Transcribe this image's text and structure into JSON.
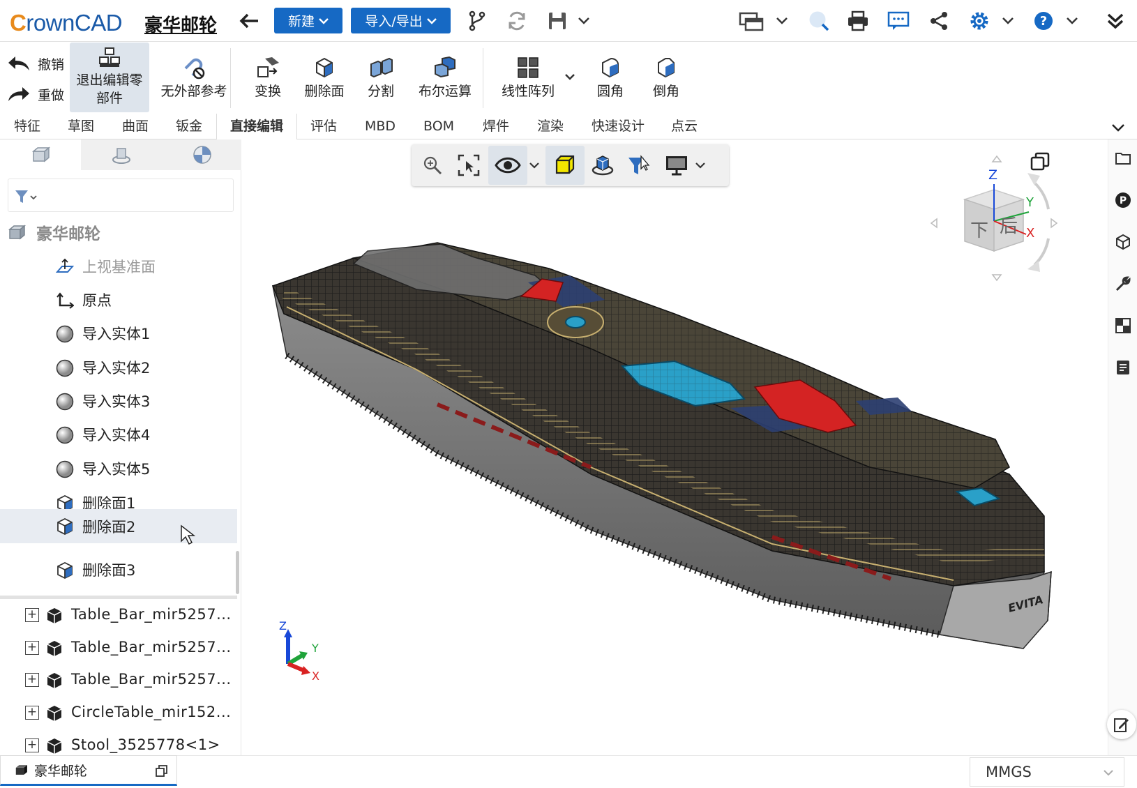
{
  "app": {
    "logo_text": "CrownCAD",
    "document_title": "豪华邮轮"
  },
  "topbar": {
    "new_label": "新建",
    "import_export_label": "导入/导出"
  },
  "ribbon": {
    "undo": "撤销",
    "redo": "重做",
    "exit_edit": "退出编辑零部件",
    "no_external_ref": "无外部参考",
    "transform": "变换",
    "delete_face": "删除面",
    "split": "分割",
    "boolean": "布尔运算",
    "linear_pattern": "线性阵列",
    "fillet": "圆角",
    "chamfer": "倒角"
  },
  "tabs": [
    "特征",
    "草图",
    "曲面",
    "钣金",
    "直接编辑",
    "评估",
    "MBD",
    "BOM",
    "焊件",
    "渲染",
    "快速设计",
    "点云"
  ],
  "active_tab": "直接编辑",
  "tree": {
    "root": "豪华邮轮",
    "items": [
      {
        "label": "上视基准面",
        "icon": "plane-icon"
      },
      {
        "label": "原点",
        "icon": "origin-icon"
      },
      {
        "label": "导入实体1",
        "icon": "sphere-icon"
      },
      {
        "label": "导入实体2",
        "icon": "sphere-icon"
      },
      {
        "label": "导入实体3",
        "icon": "sphere-icon"
      },
      {
        "label": "导入实体4",
        "icon": "sphere-icon"
      },
      {
        "label": "导入实体5",
        "icon": "sphere-icon"
      },
      {
        "label": "删除面1",
        "icon": "delete-face-icon"
      },
      {
        "label": "删除面2",
        "icon": "delete-face-icon"
      },
      {
        "label": "删除面3",
        "icon": "delete-face-icon"
      }
    ],
    "selected_index": 8,
    "subparts": [
      "Table_Bar_mir5257...",
      "Table_Bar_mir5257...",
      "Table_Bar_mir5257...",
      "CircleTable_mir152...",
      "Stool_3525778<1>"
    ]
  },
  "view_cube": {
    "top": "Z",
    "front": "下",
    "right": "后",
    "axis_x": "X",
    "axis_y": "Y",
    "axis_z": "Z"
  },
  "triad": {
    "x": "X",
    "y": "Y",
    "z": "Z"
  },
  "model_label": "EVITA",
  "doc_tab": "豪华邮轮",
  "units": "MMGS",
  "colors": {
    "accent": "#1669c4",
    "selected_row": "#e8ecf2"
  }
}
